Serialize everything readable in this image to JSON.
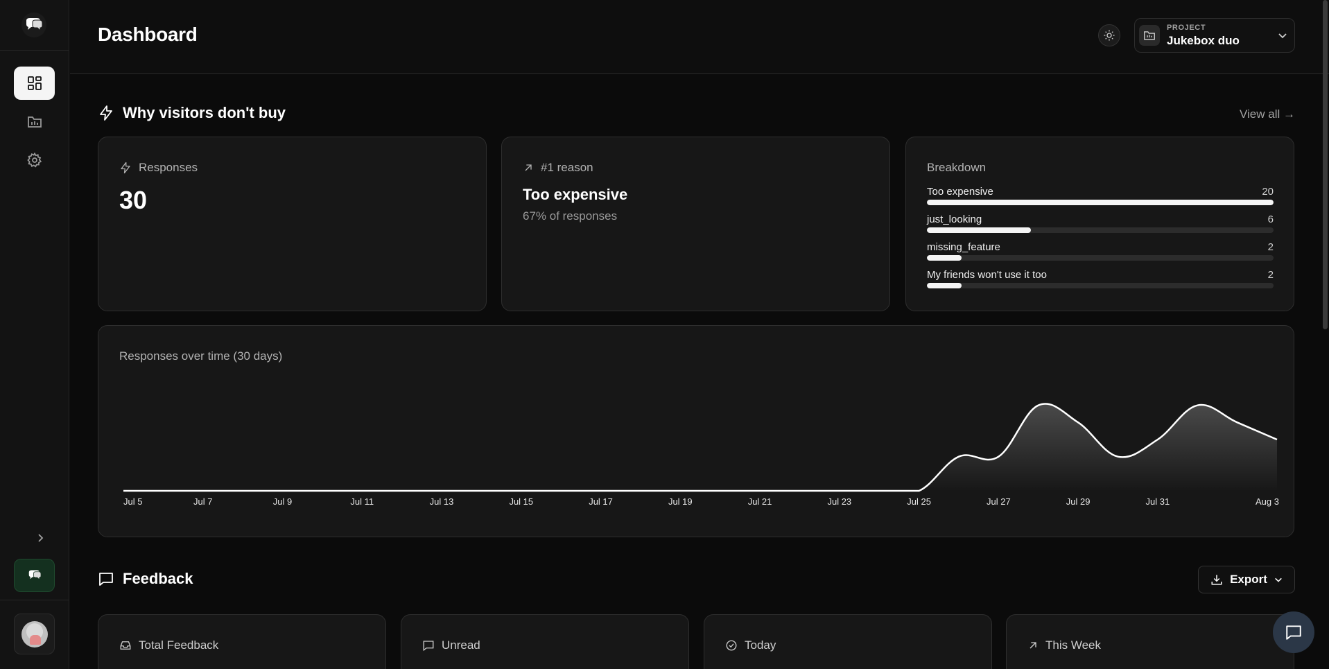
{
  "header": {
    "title": "Dashboard"
  },
  "project": {
    "label": "PROJECT",
    "name": "Jukebox duo"
  },
  "insights": {
    "title": "Why visitors don't buy",
    "view_all": "View all →",
    "responses": {
      "label": "Responses",
      "value": "30"
    },
    "top_reason": {
      "label": "#1 reason",
      "value": "Too expensive",
      "sub": "67% of responses"
    },
    "breakdown": {
      "title": "Breakdown",
      "items": [
        {
          "name": "Too expensive",
          "value": "20",
          "fraction": 1.0
        },
        {
          "name": "just_looking",
          "value": "6",
          "fraction": 0.3
        },
        {
          "name": "missing_feature",
          "value": "2",
          "fraction": 0.1
        },
        {
          "name": "My friends won't use it too",
          "value": "2",
          "fraction": 0.1
        }
      ]
    }
  },
  "chart_data": {
    "type": "area",
    "title": "Responses over time (30 days)",
    "x": [
      "Jul 5",
      "Jul 6",
      "Jul 7",
      "Jul 8",
      "Jul 9",
      "Jul 10",
      "Jul 11",
      "Jul 12",
      "Jul 13",
      "Jul 14",
      "Jul 15",
      "Jul 16",
      "Jul 17",
      "Jul 18",
      "Jul 19",
      "Jul 20",
      "Jul 21",
      "Jul 22",
      "Jul 23",
      "Jul 24",
      "Jul 25",
      "Jul 26",
      "Jul 27",
      "Jul 28",
      "Jul 29",
      "Jul 30",
      "Jul 31",
      "Aug 1",
      "Aug 2",
      "Aug 3"
    ],
    "values": [
      0,
      0,
      0,
      0,
      0,
      0,
      0,
      0,
      0,
      0,
      0,
      0,
      0,
      0,
      0,
      0,
      0,
      0,
      0,
      0,
      0,
      4,
      4,
      10,
      8,
      4,
      6,
      10,
      8,
      6
    ],
    "tick_labels": [
      "Jul 5",
      "Jul 7",
      "Jul 9",
      "Jul 11",
      "Jul 13",
      "Jul 15",
      "Jul 17",
      "Jul 19",
      "Jul 21",
      "Jul 23",
      "Jul 25",
      "Jul 27",
      "Jul 29",
      "Jul 31",
      "Aug 3"
    ],
    "ylim": [
      0,
      12
    ],
    "grid": false,
    "line_color": "#ffffff"
  },
  "feedback": {
    "title": "Feedback",
    "export_label": "Export",
    "stats": [
      {
        "label": "Total Feedback",
        "icon": "inbox-icon"
      },
      {
        "label": "Unread",
        "icon": "message-icon"
      },
      {
        "label": "Today",
        "icon": "check-circle-icon"
      },
      {
        "label": "This Week",
        "icon": "arrow-up-right-icon"
      }
    ]
  },
  "colors": {
    "background": "#0b0b0b",
    "card": "#171717",
    "border": "#2e2e2e",
    "accent": "#ffffff",
    "widget_green": "#14301f"
  }
}
